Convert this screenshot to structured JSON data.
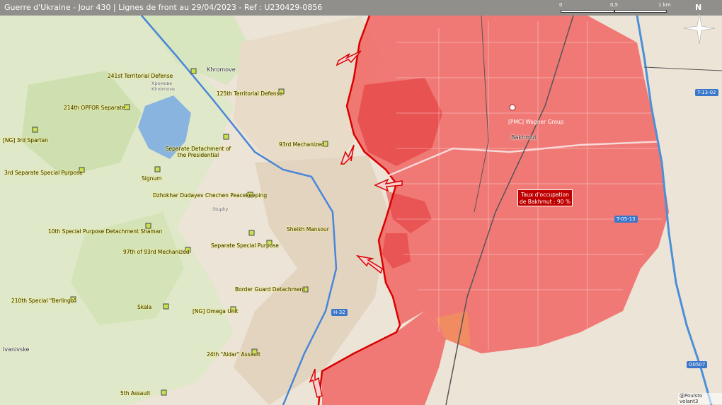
{
  "header": {
    "title": "Guerre d'Ukraine - Jour 430 | Lignes de front au 29/04/2023 - Ref : U230429-0856"
  },
  "scale": {
    "labels": [
      "0",
      "0,5",
      "1 km"
    ]
  },
  "compass": {
    "north": "N"
  },
  "places": [
    {
      "name": "Khromove"
    },
    {
      "name": "Хромове\nKhromove"
    },
    {
      "name": "Bakhmut"
    },
    {
      "name": "Ivanivske"
    },
    {
      "name": "Stupky"
    }
  ],
  "roads": [
    {
      "label": "H-32"
    },
    {
      "label": "T-13-02"
    },
    {
      "label": "T-05-13"
    },
    {
      "label": "O0507"
    }
  ],
  "units": [
    {
      "name": "241st Territorial Defense"
    },
    {
      "name": "125th Territorial Defense"
    },
    {
      "name": "214th OPFOR Separate"
    },
    {
      "name": "[NG] 3rd Spartan"
    },
    {
      "name": "Separate Detachment of the Presidential"
    },
    {
      "name": "93rd Mechanized"
    },
    {
      "name": "3rd Separate Special Purpose"
    },
    {
      "name": "Signum"
    },
    {
      "name": "Dzhokhar Dudayev Chechen Peacekeeping"
    },
    {
      "name": "10th Special Purpose Detachment Shaman"
    },
    {
      "name": "Sheikh Mansour"
    },
    {
      "name": "97th of 93rd Mechanized"
    },
    {
      "name": "Separate Special Purpose"
    },
    {
      "name": "Border Guard Detachment"
    },
    {
      "name": "210th Special \"Berlingo\""
    },
    {
      "name": "Skala"
    },
    {
      "name": "[NG] Omega Unit"
    },
    {
      "name": "24th \"Aidar\" Assault"
    },
    {
      "name": "5th Assault"
    },
    {
      "name": "[PMC] Wagner Group"
    }
  ],
  "occupation": {
    "line1": "Taux d'occupation",
    "line2": "de Bakhmut : 90 %"
  },
  "credit": "@Poulsto volant3",
  "colors": {
    "occupied": "#f0625f",
    "front_line": "#d90000",
    "road_blue": "#4a86d8",
    "river": "#4a90d9",
    "topbar": "#6e6e6e"
  }
}
